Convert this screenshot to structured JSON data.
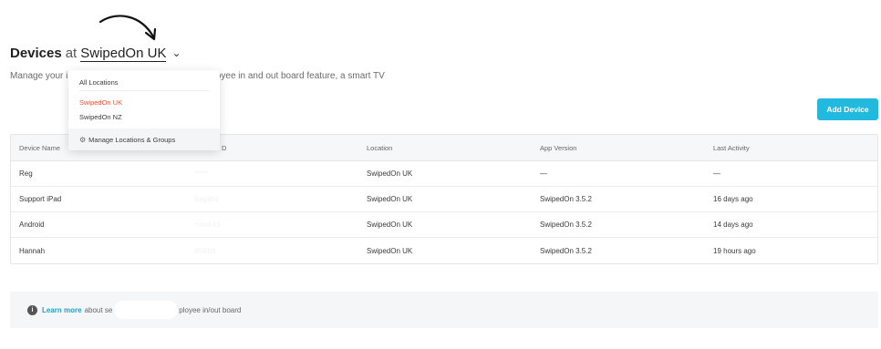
{
  "header": {
    "title_strong": "Devices",
    "title_at": "at",
    "location": "SwipedOn UK",
    "subtitle_start": "Manage your iP",
    "subtitle_end": "ployee in and out board feature, a smart TV"
  },
  "dropdown": {
    "all": "All Locations",
    "items": [
      "SwipedOn UK",
      "SwipedOn NZ"
    ],
    "manage": "Manage Locations & Groups",
    "active_color": "#e2553a"
  },
  "add_button": "Add Device",
  "table": {
    "columns": [
      "Device Name",
      "D",
      "Location",
      "App Version",
      "Last Activity"
    ],
    "rows": [
      {
        "name": "Reg",
        "id": "*****",
        "location": "SwipedOn UK",
        "version": "—",
        "activity": "—"
      },
      {
        "name": "Support iPad",
        "id": "8ag4hd",
        "location": "SwipedOn UK",
        "version": "SwipedOn 3.5.2",
        "activity": "16 days ago"
      },
      {
        "name": "Android",
        "id": "mnek43",
        "location": "SwipedOn UK",
        "version": "SwipedOn 3.5.2",
        "activity": "14 days ago"
      },
      {
        "name": "Hannah",
        "id": "45ikb9",
        "location": "SwipedOn UK",
        "version": "SwipedOn 3.5.2",
        "activity": "19 hours ago"
      }
    ]
  },
  "info": {
    "link": "Learn more",
    "text_start": "about se",
    "text_end": "ployee in/out board"
  },
  "colors": {
    "accent": "#22b9df",
    "link": "#22a0c7"
  }
}
